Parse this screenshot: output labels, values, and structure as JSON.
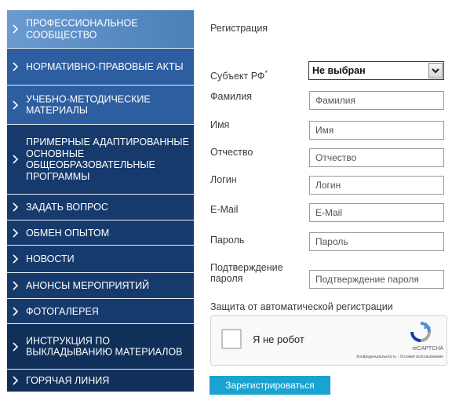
{
  "colors": {
    "nav_light": "#5a8ec4",
    "nav_mid": "#2d5ea0",
    "nav_dark": "#173a6c",
    "nav_deepest": "#102f59",
    "button": "#1aa3d1"
  },
  "sidebar": {
    "items": [
      {
        "label": "ПРОФЕССИОНАЛЬНОЕ СООБЩЕСТВО"
      },
      {
        "label": "НОРМАТИВНО-ПРАВОВЫЕ АКТЫ"
      },
      {
        "label": "УЧЕБНО-МЕТОДИЧЕСКИЕ МАТЕРИАЛЫ"
      },
      {
        "label": "ПРИМЕРНЫЕ АДАПТИРОВАННЫЕ ОСНОВНЫЕ ОБЩЕОБРАЗОВАТЕЛЬНЫЕ ПРОГРАММЫ"
      },
      {
        "label": "ЗАДАТЬ ВОПРОС"
      },
      {
        "label": "ОБМЕН ОПЫТОМ"
      },
      {
        "label": "НОВОСТИ"
      },
      {
        "label": "АНОНСЫ МЕРОПРИЯТИЙ"
      },
      {
        "label": "ФОТОГАЛЕРЕЯ"
      },
      {
        "label": "ИНСТРУКЦИЯ ПО ВЫКЛАДЫВАНИЮ МАТЕРИАЛОВ"
      },
      {
        "label": "ГОРЯЧАЯ ЛИНИЯ"
      }
    ]
  },
  "form": {
    "title": "Регистрация",
    "subject_label": "Субъект РФ",
    "subject_required_mark": "*",
    "subject_value": "Не выбран",
    "lastname_label": "Фамилия",
    "lastname_placeholder": "Фамилия",
    "firstname_label": "Имя",
    "firstname_placeholder": "Имя",
    "middlename_label": "Отчество",
    "middlename_placeholder": "Отчество",
    "login_label": "Логин",
    "login_placeholder": "Логин",
    "email_label": "E-Mail",
    "email_placeholder": "E-Mail",
    "password_label": "Пароль",
    "password_placeholder": "Пароль",
    "confirm_label_line1": "Подтверждение",
    "confirm_label_line2": "пароля",
    "confirm_placeholder": "Подтверждение пароля",
    "antibot_label": "Защита от автоматической регистрации",
    "submit_label": "Зарегистрироваться"
  },
  "captcha": {
    "checkbox_label": "Я не робот",
    "brand": "reCAPTCHA",
    "privacy": "Конфиденциальность",
    "separator": "-",
    "terms": "Условия использования",
    "logo_icon": "recaptcha-logo-icon"
  }
}
